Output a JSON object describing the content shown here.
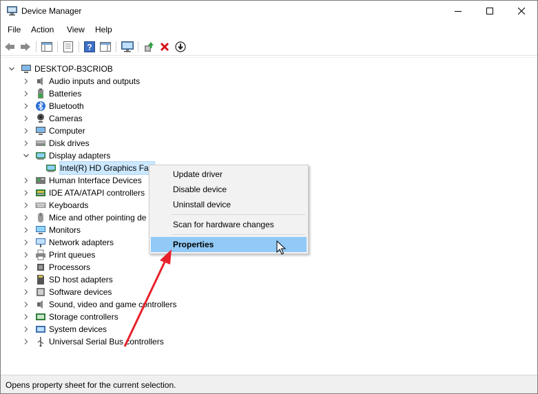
{
  "window": {
    "title": "Device Manager"
  },
  "menu": [
    "File",
    "Action",
    "View",
    "Help"
  ],
  "tree": {
    "root": "DESKTOP-B3CRIOB",
    "categories": [
      {
        "label": "Audio inputs and outputs",
        "icon": "speaker-icon"
      },
      {
        "label": "Batteries",
        "icon": "battery-icon"
      },
      {
        "label": "Bluetooth",
        "icon": "bluetooth-icon"
      },
      {
        "label": "Cameras",
        "icon": "camera-icon"
      },
      {
        "label": "Computer",
        "icon": "computer-icon"
      },
      {
        "label": "Disk drives",
        "icon": "disk-drive-icon"
      },
      {
        "label": "Display adapters",
        "icon": "display-adapter-icon"
      },
      {
        "label": "Human Interface Devices",
        "icon": "hid-icon"
      },
      {
        "label": "IDE ATA/ATAPI controllers",
        "icon": "ide-controller-icon"
      },
      {
        "label": "Keyboards",
        "icon": "keyboard-icon"
      },
      {
        "label": "Mice and other pointing de",
        "icon": "mouse-icon"
      },
      {
        "label": "Monitors",
        "icon": "monitor-icon"
      },
      {
        "label": "Network adapters",
        "icon": "network-adapter-icon"
      },
      {
        "label": "Print queues",
        "icon": "printer-icon"
      },
      {
        "label": "Processors",
        "icon": "processor-icon"
      },
      {
        "label": "SD host adapters",
        "icon": "sd-host-icon"
      },
      {
        "label": "Software devices",
        "icon": "software-device-icon"
      },
      {
        "label": "Sound, video and game controllers",
        "icon": "sound-icon"
      },
      {
        "label": "Storage controllers",
        "icon": "storage-controller-icon"
      },
      {
        "label": "System devices",
        "icon": "system-device-icon"
      },
      {
        "label": "Universal Serial Bus controllers",
        "icon": "usb-icon"
      }
    ],
    "selected_child": "Intel(R) HD Graphics Fan"
  },
  "context_menu": {
    "items": [
      "Update driver",
      "Disable device",
      "Uninstall device",
      "Scan for hardware changes",
      "Properties"
    ],
    "active": "Properties"
  },
  "status": {
    "text": "Opens property sheet for the current selection."
  },
  "colors": {
    "selection": "#cce8ff",
    "menu_highlight": "#91c9f7",
    "arrow": "#e8202a"
  }
}
